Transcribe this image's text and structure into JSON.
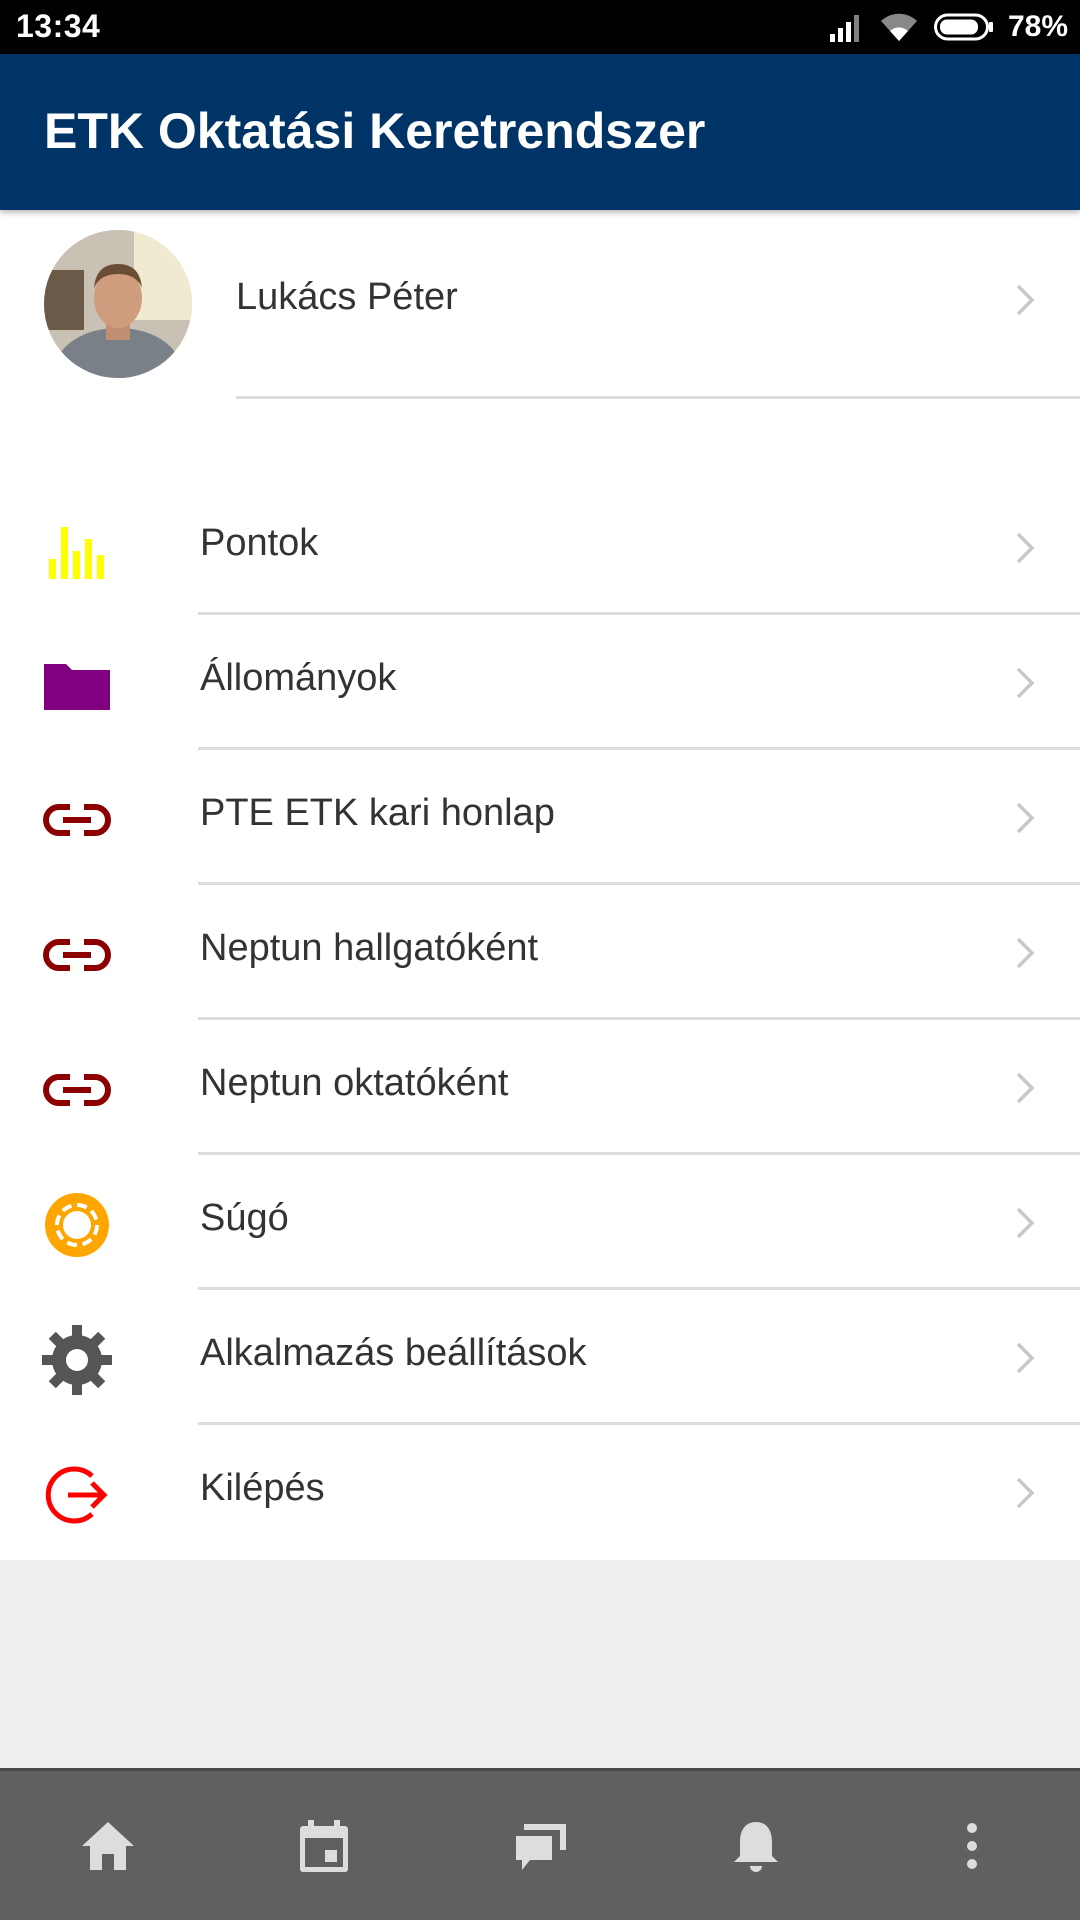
{
  "status_bar": {
    "time": "13:34",
    "battery": "78%"
  },
  "app_bar": {
    "title": "ETK Oktatási Keretrendszer"
  },
  "profile": {
    "name": "Lukács Péter",
    "avatar_icon": "user-photo"
  },
  "menu": [
    {
      "label": "Pontok",
      "icon": "bar-chart-icon",
      "color": "#FFFF00"
    },
    {
      "label": "Állományok",
      "icon": "folder-icon",
      "color": "#800080"
    },
    {
      "label": "PTE ETK kari honlap",
      "icon": "link-icon",
      "color": "#8B0000"
    },
    {
      "label": "Neptun hallgatóként",
      "icon": "link-icon",
      "color": "#8B0000"
    },
    {
      "label": "Neptun oktatóként",
      "icon": "link-icon",
      "color": "#8B0000"
    },
    {
      "label": "Súgó",
      "icon": "lifebuoy-icon",
      "color": "#FFA500"
    },
    {
      "label": "Alkalmazás beállítások",
      "icon": "gear-icon",
      "color": "#555555"
    },
    {
      "label": "Kilépés",
      "icon": "logout-icon",
      "color": "#FF0000"
    }
  ],
  "bottom_nav": [
    "home-icon",
    "calendar-icon",
    "chat-icon",
    "bell-icon",
    "more-vert-icon"
  ],
  "colors": {
    "app_bar": "#003366",
    "bottom_nav": "#606060",
    "background": "#EEEEEE"
  }
}
